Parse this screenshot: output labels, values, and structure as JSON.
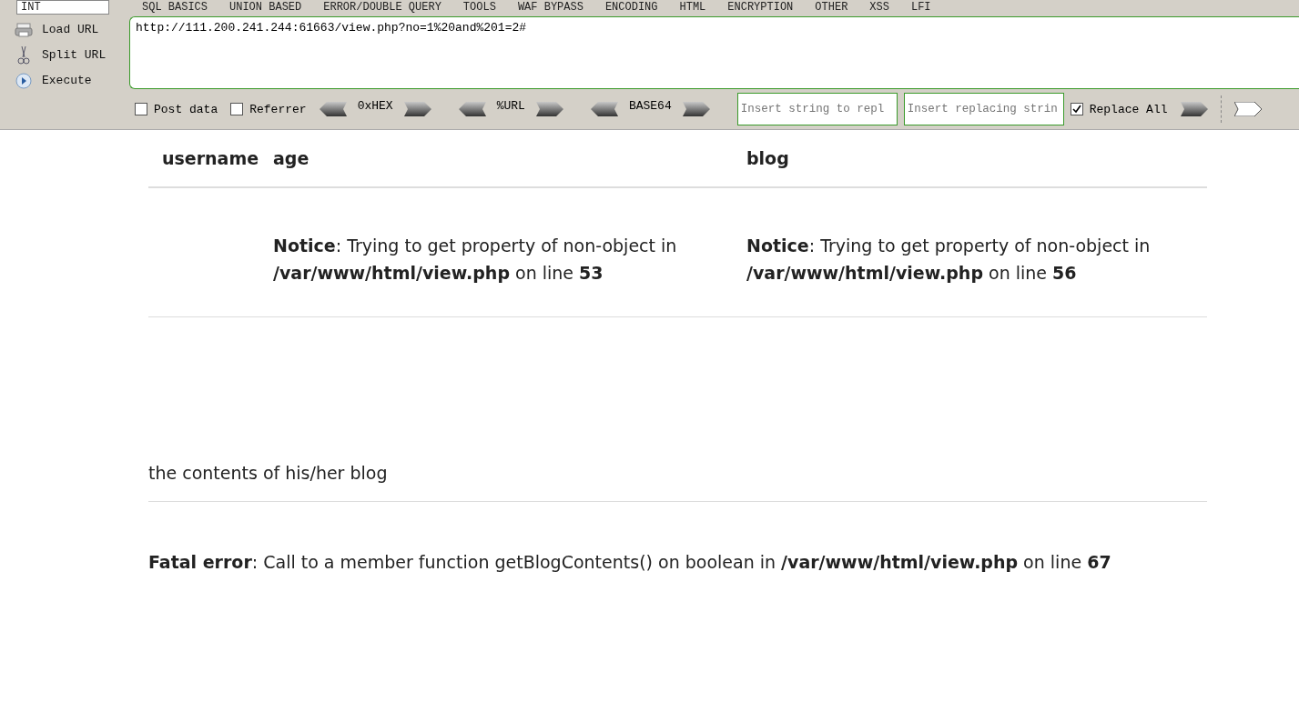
{
  "toolbar": {
    "type_select": "INT",
    "menu": [
      "SQL BASICS",
      "UNION BASED",
      "ERROR/DOUBLE QUERY",
      "TOOLS",
      "WAF BYPASS",
      "ENCODING",
      "HTML",
      "ENCRYPTION",
      "OTHER",
      "XSS",
      "LFI"
    ],
    "actions": [
      {
        "kind": "load",
        "label": "Load URL"
      },
      {
        "kind": "split",
        "label": "Split URL"
      },
      {
        "kind": "execute",
        "label": "Execute"
      }
    ],
    "url": "http://111.200.241.244:61663/view.php?no=1%20and%201=2#",
    "post_data": {
      "label": "Post data",
      "checked": false
    },
    "referrer": {
      "label": "Referrer",
      "checked": false
    },
    "encoders": [
      "0xHEX",
      "%URL",
      "BASE64"
    ],
    "find": {
      "placeholder": "Insert string to repl"
    },
    "replace": {
      "placeholder": "Insert replacing strin"
    },
    "replace_all": {
      "label": "Replace All",
      "checked": true
    }
  },
  "table": {
    "columns": [
      "username",
      "age",
      "blog"
    ],
    "rows": [
      [
        "",
        "**Notice**: Trying to get property of non-object in **/var/www/html/view.php** on line **53**",
        "**Notice**: Trying to get property of non-object in **/var/www/html/view.php** on line **56**"
      ]
    ]
  },
  "blog_heading": "the contents of his/her blog",
  "fatal_error": "**Fatal error**: Call to a member function getBlogContents() on boolean in **/var/www/html/view.php** on line **67**"
}
